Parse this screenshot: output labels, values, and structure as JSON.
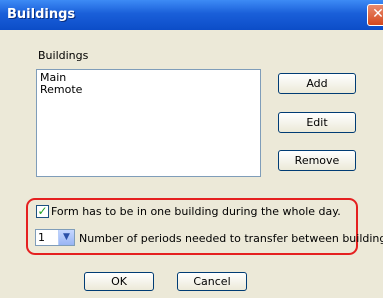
{
  "window": {
    "title": "Buildings",
    "close_symbol": "✕"
  },
  "buildings_label": "Buildings",
  "buildings_list": [
    "Main",
    "Remote"
  ],
  "buttons": {
    "add": "Add",
    "edit": "Edit",
    "remove": "Remove",
    "ok": "OK",
    "cancel": "Cancel"
  },
  "options": {
    "one_building_checked": true,
    "one_building_label": "Form has to be in one building during the whole day.",
    "periods_value": "1",
    "periods_label": "Number of periods needed to transfer between buildings."
  },
  "colors": {
    "highlight": "#e52020",
    "titlebar": "#1a5fd9",
    "dialog_bg": "#ece9d8"
  }
}
